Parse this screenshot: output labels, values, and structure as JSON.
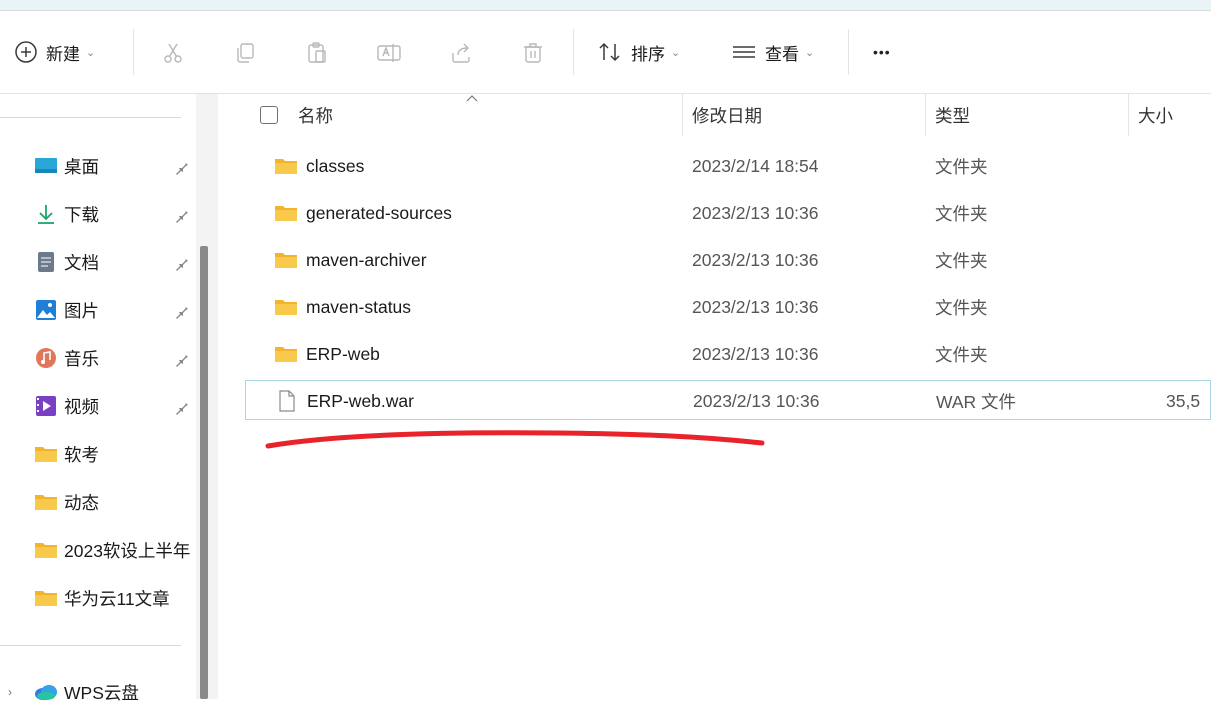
{
  "toolbar": {
    "new_label": "新建",
    "sort_label": "排序",
    "view_label": "查看",
    "more_label": "•••"
  },
  "sidebar": {
    "items": [
      {
        "label": "桌面",
        "icon": "desktop-icon",
        "pinned": true
      },
      {
        "label": "下载",
        "icon": "download-icon",
        "pinned": true
      },
      {
        "label": "文档",
        "icon": "document-icon",
        "pinned": true
      },
      {
        "label": "图片",
        "icon": "picture-icon",
        "pinned": true
      },
      {
        "label": "音乐",
        "icon": "music-icon",
        "pinned": true
      },
      {
        "label": "视频",
        "icon": "video-icon",
        "pinned": true
      },
      {
        "label": "软考",
        "icon": "folder-icon",
        "pinned": false
      },
      {
        "label": "动态",
        "icon": "folder-icon",
        "pinned": false
      },
      {
        "label": "2023软设上半年",
        "icon": "folder-icon",
        "pinned": false
      },
      {
        "label": "华为云11文章",
        "icon": "folder-icon",
        "pinned": false
      }
    ],
    "wps_label": "WPS云盘"
  },
  "columns": {
    "name": "名称",
    "date": "修改日期",
    "type": "类型",
    "size": "大小"
  },
  "files": [
    {
      "name": "classes",
      "date": "2023/2/14 18:54",
      "type": "文件夹",
      "size": "",
      "icon": "folder-icon"
    },
    {
      "name": "generated-sources",
      "date": "2023/2/13 10:36",
      "type": "文件夹",
      "size": "",
      "icon": "folder-icon"
    },
    {
      "name": "maven-archiver",
      "date": "2023/2/13 10:36",
      "type": "文件夹",
      "size": "",
      "icon": "folder-icon"
    },
    {
      "name": "maven-status",
      "date": "2023/2/13 10:36",
      "type": "文件夹",
      "size": "",
      "icon": "folder-icon"
    },
    {
      "name": "ERP-web",
      "date": "2023/2/13 10:36",
      "type": "文件夹",
      "size": "",
      "icon": "folder-icon"
    },
    {
      "name": "ERP-web.war",
      "date": "2023/2/13 10:36",
      "type": "WAR 文件",
      "size": "35,5",
      "icon": "file-icon"
    }
  ],
  "colors": {
    "folder": "#f8c94b",
    "selection_border": "#a9d6e6",
    "annotation": "#e8232a"
  }
}
